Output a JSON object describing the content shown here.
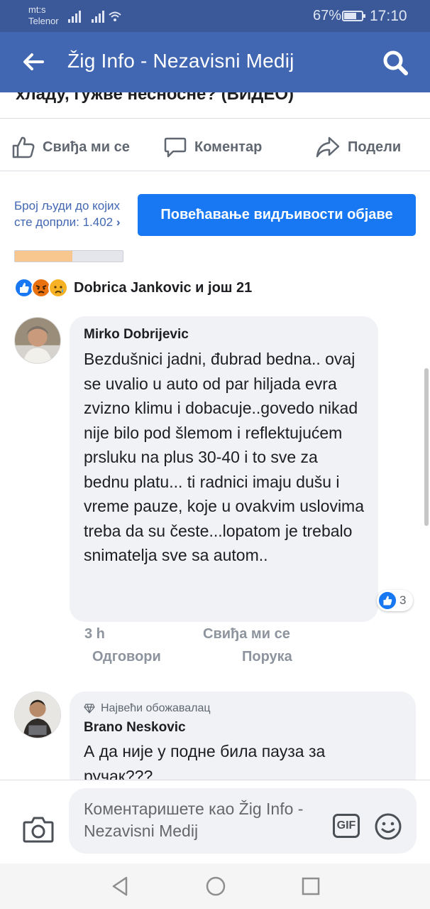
{
  "status": {
    "carrier_line1": "mt:s",
    "carrier_line2": "Telenor",
    "battery": "67%",
    "time": "17:10"
  },
  "header": {
    "title": "Žig Info - Nezavisni Medij"
  },
  "post": {
    "title_fragment": "хладу, гужве несносне? (ВИДЕО)"
  },
  "actions": {
    "like": "Свиђа ми се",
    "comment": "Коментар",
    "share": "Подели"
  },
  "reach": {
    "label": "Број људи до којих сте допрли: 1.402",
    "progress_fraction": 0.53
  },
  "boost": {
    "label": "Повећавање видљивости објаве"
  },
  "reactions": {
    "summary": "Dobrica Jankovic и још 21",
    "icons": [
      "like-icon",
      "angry-icon",
      "sad-icon"
    ]
  },
  "comments": [
    {
      "author": "Mirko Dobrijevic",
      "text": "Bezdušnici jadni, đubrad bedna.. ovaj se uvalio u auto od par hiljada evra zvizno klimu i dobacuje..govedo nikad nije bilo pod šlemom i reflektujućem prsluku na plus 30-40 i to sve za bednu platu... ti radnici imaju dušu i vreme pauze, koje u ovakvim uslovima treba da su česte...lopatom je trebalo snimatelja sve sa autom..",
      "likes": "3",
      "time": "3 h",
      "like_action": "Свиђа ми се",
      "reply_action": "Одговори",
      "message_action": "Порука"
    },
    {
      "badge": "Највећи обожавалац",
      "author": "Brano Neskovic",
      "text": "А да није у подне била пауза за ручак???"
    }
  ],
  "composer": {
    "placeholder": "Коментаришете као Žig Info - Nezavisni Medij",
    "gif_label": "GIF"
  },
  "colors": {
    "brand": "#4267b2",
    "status_bar": "#3b5998",
    "button": "#1877f2"
  }
}
